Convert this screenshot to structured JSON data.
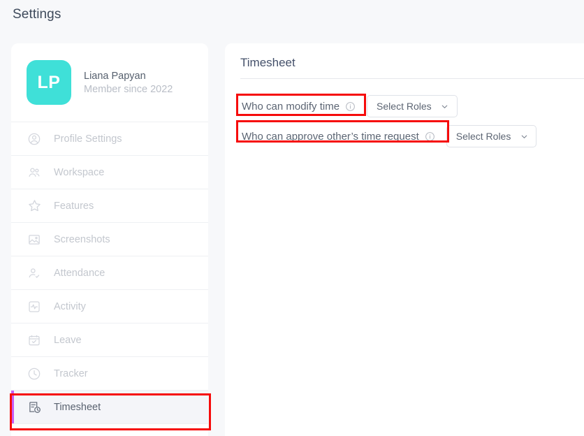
{
  "header": {
    "title": "Settings"
  },
  "profile": {
    "initials": "LP",
    "name": "Liana Papyan",
    "member_since": "Member since 2022",
    "avatar_color": "#3fe0d8"
  },
  "sidebar": {
    "items": [
      {
        "label": "Profile Settings",
        "icon": "user-circle-icon",
        "active": false
      },
      {
        "label": "Workspace",
        "icon": "users-icon",
        "active": false
      },
      {
        "label": "Features",
        "icon": "star-icon",
        "active": false
      },
      {
        "label": "Screenshots",
        "icon": "image-icon",
        "active": false
      },
      {
        "label": "Attendance",
        "icon": "user-check-icon",
        "active": false
      },
      {
        "label": "Activity",
        "icon": "activity-icon",
        "active": false
      },
      {
        "label": "Leave",
        "icon": "calendar-check-icon",
        "active": false
      },
      {
        "label": "Tracker",
        "icon": "clock-icon",
        "active": false
      },
      {
        "label": "Timesheet",
        "icon": "timesheet-icon",
        "active": true
      }
    ],
    "active_accent_color": "#c85cf5"
  },
  "main": {
    "title": "Timesheet",
    "settings": [
      {
        "label": "Who can modify time",
        "info_icon": "info-icon",
        "select_value": "Select Roles",
        "chevron": "chevron-down-icon"
      },
      {
        "label": "Who can approve other’s time request",
        "info_icon": "info-icon",
        "select_value": "Select Roles",
        "chevron": "chevron-down-icon"
      }
    ]
  },
  "annotations": {
    "color": "#f60b0b",
    "boxes": [
      {
        "target": "who-can-modify-time-label"
      },
      {
        "target": "who-can-approve-label"
      },
      {
        "target": "sidebar-item-timesheet"
      }
    ]
  }
}
